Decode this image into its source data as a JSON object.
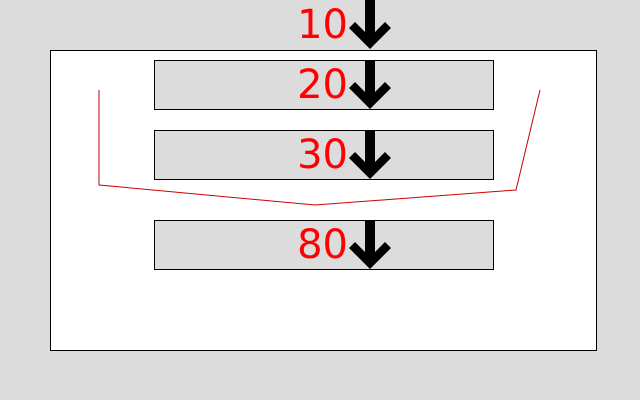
{
  "colors": {
    "background": "#dcdcdc",
    "panel": "#ffffff",
    "box": "#dcdcdc",
    "label": "#ff0000",
    "arrow": "#000000",
    "bracket": "#cc0000"
  },
  "steps": [
    {
      "label": "10",
      "icon": "arrow-down-icon"
    },
    {
      "label": "20",
      "icon": "arrow-down-icon"
    },
    {
      "label": "30",
      "icon": "arrow-down-icon"
    },
    {
      "label": "80",
      "icon": "arrow-down-icon"
    }
  ]
}
